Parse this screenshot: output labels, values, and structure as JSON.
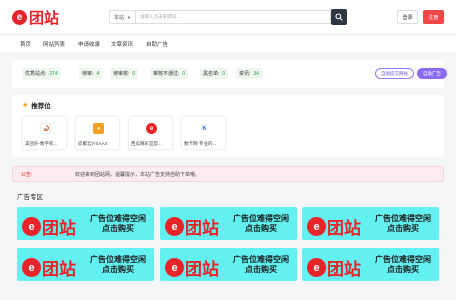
{
  "header": {
    "logo_mark": "e",
    "logo_text": "团站",
    "search_select": "本站",
    "search_placeholder": "请输入点击关键词...",
    "login": "登录",
    "register": "注册"
  },
  "nav": [
    "首页",
    "网站列表",
    "申请收录",
    "文章资讯",
    "自助广告"
  ],
  "stats": [
    {
      "label": "优秀站点:",
      "value": "274"
    },
    {
      "label": "待审:",
      "value": "4"
    },
    {
      "label": "待审核:",
      "value": "0"
    },
    {
      "label": "审核不通过:",
      "value": "0"
    },
    {
      "label": "黑名单:",
      "value": "0"
    },
    {
      "label": "资讯:",
      "value": "34"
    }
  ],
  "actions": {
    "submit": "自助提交网站",
    "ads": "自助广告"
  },
  "recommend": {
    "title": "推荐位",
    "cards": [
      {
        "label": "美团外-数字权..."
      },
      {
        "label": "玖聚云|YSAAS"
      },
      {
        "label": "西瓜精彩宜官..."
      },
      {
        "label": "数卡网-专业的..."
      }
    ]
  },
  "notice": {
    "label": "公告:",
    "text": "欢迎来到团站网，温馨提示，本站广告支持自助下单哦。"
  },
  "ad_section": {
    "title": "广告专区",
    "ads": [
      {
        "line1": "广告位难得空闲",
        "line2": "点击购买"
      },
      {
        "line1": "广告位难得空闲",
        "line2": "点击购买"
      },
      {
        "line1": "广告位难得空闲",
        "line2": "点击购买"
      },
      {
        "line1": "广告位难得空闲",
        "line2": "点击购买"
      },
      {
        "line1": "广告位难得空闲",
        "line2": "点击购买"
      },
      {
        "line1": "广告位难得空闲",
        "line2": "点击购买"
      }
    ]
  },
  "colors": {
    "brand": "#e8242a",
    "ad_bg": "#63f0f0",
    "accent_purple": "#8b6cf0",
    "stat_green": "#2e9e4a"
  }
}
